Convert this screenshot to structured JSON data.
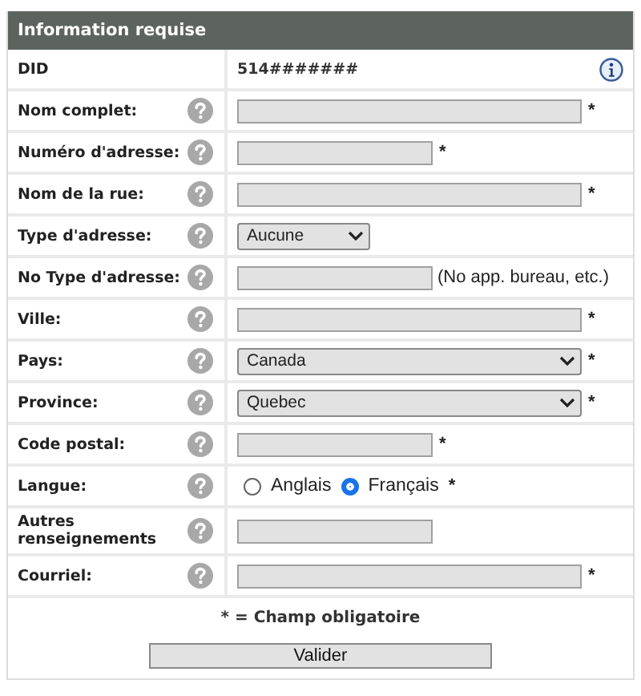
{
  "panel": {
    "title": "Information requise"
  },
  "rows": [
    {
      "kind": "static",
      "label": "DID",
      "value": "514#######",
      "info": true
    },
    {
      "kind": "text",
      "label": "Nom complet:",
      "help": true,
      "full_width": true,
      "required": true
    },
    {
      "kind": "text",
      "label": "Numéro d'adresse:",
      "help": true,
      "full_width": false,
      "required": true
    },
    {
      "kind": "text",
      "label": "Nom de la rue:",
      "help": true,
      "full_width": true,
      "required": true
    },
    {
      "kind": "select",
      "label": "Type d'adresse:",
      "help": true,
      "full_width": false,
      "value": "Aucune",
      "required": false
    },
    {
      "kind": "text",
      "label": "No Type d'adresse:",
      "help": true,
      "full_width": false,
      "required": false,
      "note": "(No app. bureau, etc.)"
    },
    {
      "kind": "text",
      "label": "Ville:",
      "help": true,
      "full_width": true,
      "required": true
    },
    {
      "kind": "select",
      "label": "Pays:",
      "help": true,
      "full_width": true,
      "value": "Canada",
      "required": true
    },
    {
      "kind": "select",
      "label": "Province:",
      "help": true,
      "full_width": true,
      "value": "Quebec",
      "required": true
    },
    {
      "kind": "text",
      "label": "Code postal:",
      "help": true,
      "full_width": false,
      "required": true
    },
    {
      "kind": "radio",
      "label": "Langue:",
      "help": true,
      "required": true,
      "options": [
        {
          "label": "Anglais",
          "selected": false
        },
        {
          "label": "Français",
          "selected": true
        }
      ]
    },
    {
      "kind": "text",
      "label": "Autres renseignements",
      "help": true,
      "full_width": false,
      "required": false
    },
    {
      "kind": "text",
      "label": "Courriel:",
      "help": true,
      "full_width": true,
      "required": true
    }
  ],
  "footer": {
    "legend": "* = Champ obligatoire",
    "required_mark": "*",
    "submit": "Valider"
  }
}
